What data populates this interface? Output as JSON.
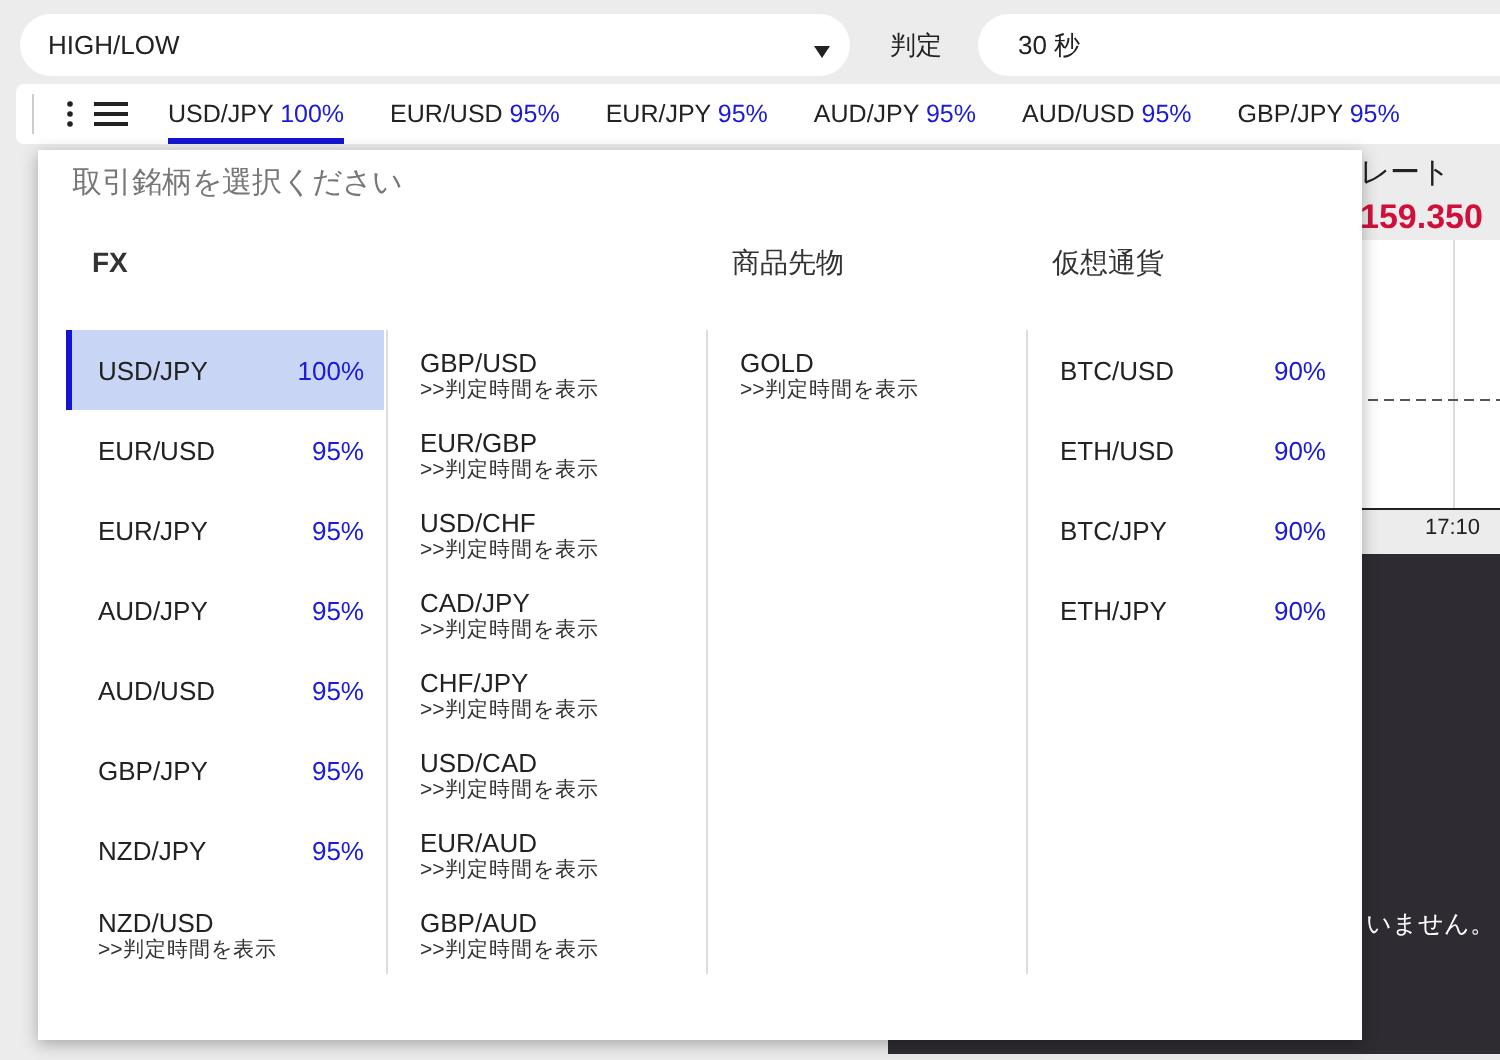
{
  "trade_type_select": {
    "value": "HIGH/LOW"
  },
  "expiry": {
    "label": "判定",
    "value": "30 秒"
  },
  "pair_tabs": [
    {
      "pair": "USD/JPY",
      "payout": "100%",
      "selected": true
    },
    {
      "pair": "EUR/USD",
      "payout": "95%",
      "selected": false
    },
    {
      "pair": "EUR/JPY",
      "payout": "95%",
      "selected": false
    },
    {
      "pair": "AUD/JPY",
      "payout": "95%",
      "selected": false
    },
    {
      "pair": "AUD/USD",
      "payout": "95%",
      "selected": false
    },
    {
      "pair": "GBP/JPY",
      "payout": "95%",
      "selected": false
    }
  ],
  "background": {
    "rate_label": "レート",
    "rate": "159.350",
    "time_tick": "17:10",
    "notice": "いません。"
  },
  "dropdown": {
    "placeholder": "取引銘柄を選択ください",
    "categories": [
      {
        "title": "FX",
        "columns": [
          [
            {
              "kind": "payout",
              "pair": "USD/JPY",
              "payout": "100%",
              "selected": true
            },
            {
              "kind": "payout",
              "pair": "EUR/USD",
              "payout": "95%",
              "selected": false
            },
            {
              "kind": "payout",
              "pair": "EUR/JPY",
              "payout": "95%",
              "selected": false
            },
            {
              "kind": "payout",
              "pair": "AUD/JPY",
              "payout": "95%",
              "selected": false
            },
            {
              "kind": "payout",
              "pair": "AUD/USD",
              "payout": "95%",
              "selected": false
            },
            {
              "kind": "payout",
              "pair": "GBP/JPY",
              "payout": "95%",
              "selected": false
            },
            {
              "kind": "payout",
              "pair": "NZD/JPY",
              "payout": "95%",
              "selected": false
            },
            {
              "kind": "schedule",
              "pair": "NZD/USD",
              "note": ">>判定時間を表示",
              "selected": false
            }
          ],
          [
            {
              "kind": "schedule",
              "pair": "GBP/USD",
              "note": ">>判定時間を表示",
              "selected": false
            },
            {
              "kind": "schedule",
              "pair": "EUR/GBP",
              "note": ">>判定時間を表示",
              "selected": false
            },
            {
              "kind": "schedule",
              "pair": "USD/CHF",
              "note": ">>判定時間を表示",
              "selected": false
            },
            {
              "kind": "schedule",
              "pair": "CAD/JPY",
              "note": ">>判定時間を表示",
              "selected": false
            },
            {
              "kind": "schedule",
              "pair": "CHF/JPY",
              "note": ">>判定時間を表示",
              "selected": false
            },
            {
              "kind": "schedule",
              "pair": "USD/CAD",
              "note": ">>判定時間を表示",
              "selected": false
            },
            {
              "kind": "schedule",
              "pair": "EUR/AUD",
              "note": ">>判定時間を表示",
              "selected": false
            },
            {
              "kind": "schedule",
              "pair": "GBP/AUD",
              "note": ">>判定時間を表示",
              "selected": false
            }
          ]
        ]
      },
      {
        "title": "商品先物",
        "columns": [
          [
            {
              "kind": "schedule",
              "pair": "GOLD",
              "note": ">>判定時間を表示",
              "selected": false
            }
          ]
        ]
      },
      {
        "title": "仮想通貨",
        "columns": [
          [
            {
              "kind": "payout",
              "pair": "BTC/USD",
              "payout": "90%",
              "selected": false
            },
            {
              "kind": "payout",
              "pair": "ETH/USD",
              "payout": "90%",
              "selected": false
            },
            {
              "kind": "payout",
              "pair": "BTC/JPY",
              "payout": "90%",
              "selected": false
            },
            {
              "kind": "payout",
              "pair": "ETH/JPY",
              "payout": "90%",
              "selected": false
            }
          ]
        ]
      }
    ]
  }
}
